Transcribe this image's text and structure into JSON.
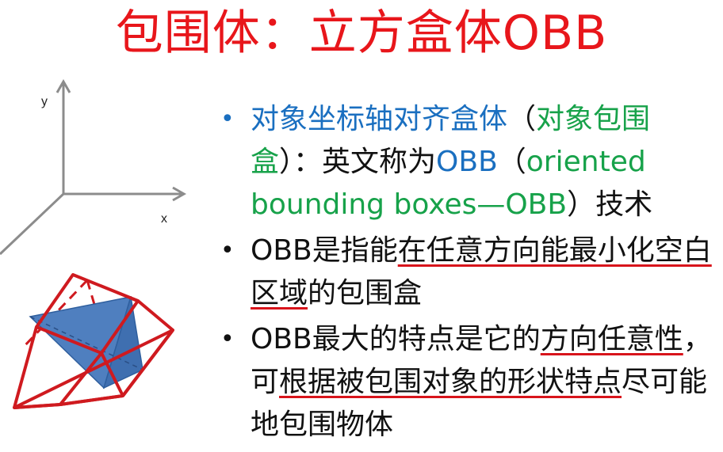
{
  "title": "包围体：立方盒体OBB",
  "figure": {
    "y_label": "y",
    "x_label": "x"
  },
  "bullets": {
    "b1": {
      "p1": "对象坐标轴对齐盒体",
      "p2": "（",
      "p3": "对象包围盒",
      "p4": "）：英文称为",
      "p5": "OBB",
      "p6": "（",
      "p7": "oriented bounding boxes—OBB",
      "p8": "）技术"
    },
    "b2": {
      "p1": "OBB是指能",
      "p2": "在任意方向能最小化空白区域",
      "p3": "的包围盒"
    },
    "b3": {
      "p1": "OBB最大的特点是它的",
      "p2": "方向任意性",
      "p3": "，可",
      "p4": "根据被包围对象的形状特点",
      "p5": "尽可能地包围物体"
    }
  },
  "colors": {
    "title": "#e8161b",
    "blue": "#1a6fc0",
    "green": "#17a24a",
    "underline": "#d8141b",
    "tetra": "#4f7fbf"
  }
}
